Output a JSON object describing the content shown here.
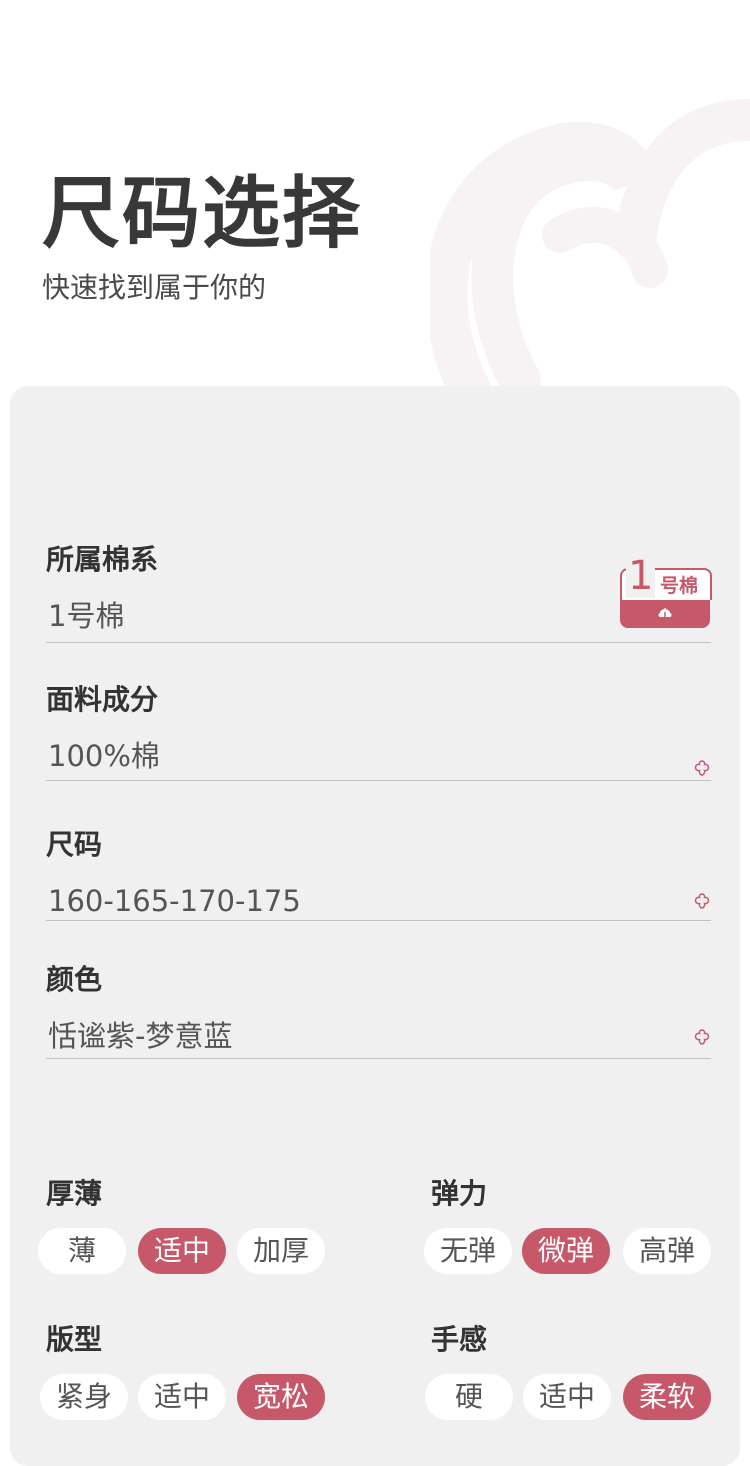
{
  "header": {
    "title": "尺码选择",
    "subtitle": "快速找到属于你的"
  },
  "colors": {
    "accent": "#c65869",
    "card_bg": "#f0f0f1",
    "pill_bg": "#ffffff"
  },
  "fields": [
    {
      "label": "所属棉系",
      "value": "1号棉"
    },
    {
      "label": "面料成分",
      "value": "100%棉"
    },
    {
      "label": "尺码",
      "value": "160-165-170-175"
    },
    {
      "label": "颜色",
      "value": "恬谧紫-梦意蓝"
    }
  ],
  "badge": {
    "number": "1",
    "text": "号棉",
    "icon": "cotton-icon"
  },
  "groups": [
    {
      "label": "厚薄",
      "options": [
        "薄",
        "适中",
        "加厚"
      ],
      "selected": "适中"
    },
    {
      "label": "弹力",
      "options": [
        "无弹",
        "微弹",
        "高弹"
      ],
      "selected": "微弹"
    },
    {
      "label": "版型",
      "options": [
        "紧身",
        "适中",
        "宽松"
      ],
      "selected": "宽松"
    },
    {
      "label": "手感",
      "options": [
        "硬",
        "适中",
        "柔软"
      ],
      "selected": "柔软"
    }
  ]
}
